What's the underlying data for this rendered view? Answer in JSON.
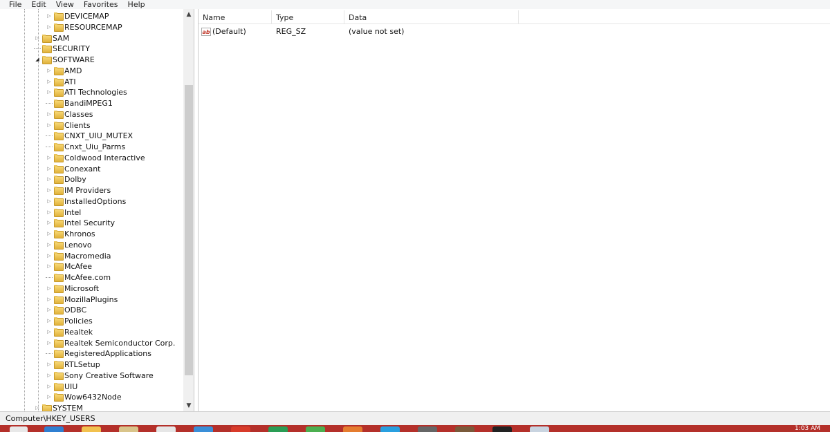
{
  "menu": [
    "File",
    "Edit",
    "View",
    "Favorites",
    "Help"
  ],
  "tree": {
    "items": [
      {
        "label": "DEVICEMAP",
        "level": 2,
        "toggle": "collapsed"
      },
      {
        "label": "RESOURCEMAP",
        "level": 2,
        "toggle": "collapsed"
      },
      {
        "label": "SAM",
        "level": 1,
        "toggle": "collapsed"
      },
      {
        "label": "SECURITY",
        "level": 1,
        "toggle": "none"
      },
      {
        "label": "SOFTWARE",
        "level": 1,
        "toggle": "expanded"
      },
      {
        "label": "AMD",
        "level": 2,
        "toggle": "collapsed"
      },
      {
        "label": "ATI",
        "level": 2,
        "toggle": "collapsed"
      },
      {
        "label": "ATI Technologies",
        "level": 2,
        "toggle": "collapsed"
      },
      {
        "label": "BandiMPEG1",
        "level": 2,
        "toggle": "none"
      },
      {
        "label": "Classes",
        "level": 2,
        "toggle": "collapsed"
      },
      {
        "label": "Clients",
        "level": 2,
        "toggle": "collapsed"
      },
      {
        "label": "CNXT_UIU_MUTEX",
        "level": 2,
        "toggle": "none"
      },
      {
        "label": "Cnxt_Uiu_Parms",
        "level": 2,
        "toggle": "none"
      },
      {
        "label": "Coldwood Interactive",
        "level": 2,
        "toggle": "collapsed"
      },
      {
        "label": "Conexant",
        "level": 2,
        "toggle": "collapsed"
      },
      {
        "label": "Dolby",
        "level": 2,
        "toggle": "collapsed"
      },
      {
        "label": "IM Providers",
        "level": 2,
        "toggle": "collapsed"
      },
      {
        "label": "InstalledOptions",
        "level": 2,
        "toggle": "collapsed"
      },
      {
        "label": "Intel",
        "level": 2,
        "toggle": "collapsed"
      },
      {
        "label": "Intel Security",
        "level": 2,
        "toggle": "collapsed"
      },
      {
        "label": "Khronos",
        "level": 2,
        "toggle": "collapsed"
      },
      {
        "label": "Lenovo",
        "level": 2,
        "toggle": "collapsed"
      },
      {
        "label": "Macromedia",
        "level": 2,
        "toggle": "collapsed"
      },
      {
        "label": "McAfee",
        "level": 2,
        "toggle": "collapsed"
      },
      {
        "label": "McAfee.com",
        "level": 2,
        "toggle": "none"
      },
      {
        "label": "Microsoft",
        "level": 2,
        "toggle": "collapsed"
      },
      {
        "label": "MozillaPlugins",
        "level": 2,
        "toggle": "collapsed"
      },
      {
        "label": "ODBC",
        "level": 2,
        "toggle": "collapsed"
      },
      {
        "label": "Policies",
        "level": 2,
        "toggle": "collapsed"
      },
      {
        "label": "Realtek",
        "level": 2,
        "toggle": "collapsed"
      },
      {
        "label": "Realtek Semiconductor Corp.",
        "level": 2,
        "toggle": "collapsed"
      },
      {
        "label": "RegisteredApplications",
        "level": 2,
        "toggle": "none"
      },
      {
        "label": "RTLSetup",
        "level": 2,
        "toggle": "collapsed"
      },
      {
        "label": "Sony Creative Software",
        "level": 2,
        "toggle": "collapsed"
      },
      {
        "label": "UIU",
        "level": 2,
        "toggle": "collapsed"
      },
      {
        "label": "Wow6432Node",
        "level": 2,
        "toggle": "collapsed"
      },
      {
        "label": "SYSTEM",
        "level": 1,
        "toggle": "collapsed"
      }
    ]
  },
  "list": {
    "columns": [
      "Name",
      "Type",
      "Data"
    ],
    "rows": [
      {
        "name": "(Default)",
        "type": "REG_SZ",
        "data": "(value not set)",
        "icon": "string-value-icon"
      }
    ]
  },
  "status": {
    "path": "Computer\\HKEY_USERS"
  },
  "taskbar": {
    "clock": "1:03 AM",
    "color": "#b4302a"
  }
}
